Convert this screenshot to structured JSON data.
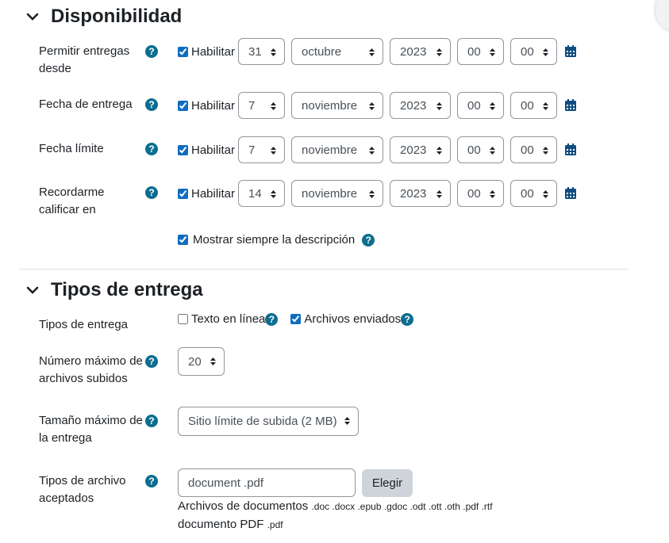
{
  "sections": {
    "availability": {
      "title": "Disponibilidad",
      "rows": [
        {
          "label": "Permitir entregas desde",
          "enable": "Habilitar",
          "day": "31",
          "month": "octubre",
          "year": "2023",
          "hour": "00",
          "minute": "00"
        },
        {
          "label": "Fecha de entrega",
          "enable": "Habilitar",
          "day": "7",
          "month": "noviembre",
          "year": "2023",
          "hour": "00",
          "minute": "00"
        },
        {
          "label": "Fecha límite",
          "enable": "Habilitar",
          "day": "7",
          "month": "noviembre",
          "year": "2023",
          "hour": "00",
          "minute": "00"
        },
        {
          "label": "Recordarme calificar en",
          "enable": "Habilitar",
          "day": "14",
          "month": "noviembre",
          "year": "2023",
          "hour": "00",
          "minute": "00"
        }
      ],
      "always_show_description": "Mostrar siempre la descripción"
    },
    "submission_types": {
      "title": "Tipos de entrega",
      "types_label": "Tipos de entrega",
      "online_text": "Texto en línea",
      "file_submissions": "Archivos enviados",
      "max_files_label": "Número máximo de archivos subidos",
      "max_files_value": "20",
      "max_size_label": "Tamaño máximo de la entrega",
      "max_size_value": "Sitio límite de subida (2 MB)",
      "accepted_label": "Tipos de archivo aceptados",
      "accepted_value": "document .pdf",
      "choose_button": "Elegir",
      "filetype_group_1_name": "Archivos de documentos",
      "filetype_group_1_exts": ".doc .docx .epub .gdoc .odt .ott .oth .pdf .rtf",
      "filetype_group_2_name": "documento PDF",
      "filetype_group_2_exts": ".pdf"
    }
  },
  "help_glyph": "?",
  "colors": {
    "help": "#0a7490",
    "checkbox": "#0f6cbf",
    "calendar": "#0f4c81"
  }
}
